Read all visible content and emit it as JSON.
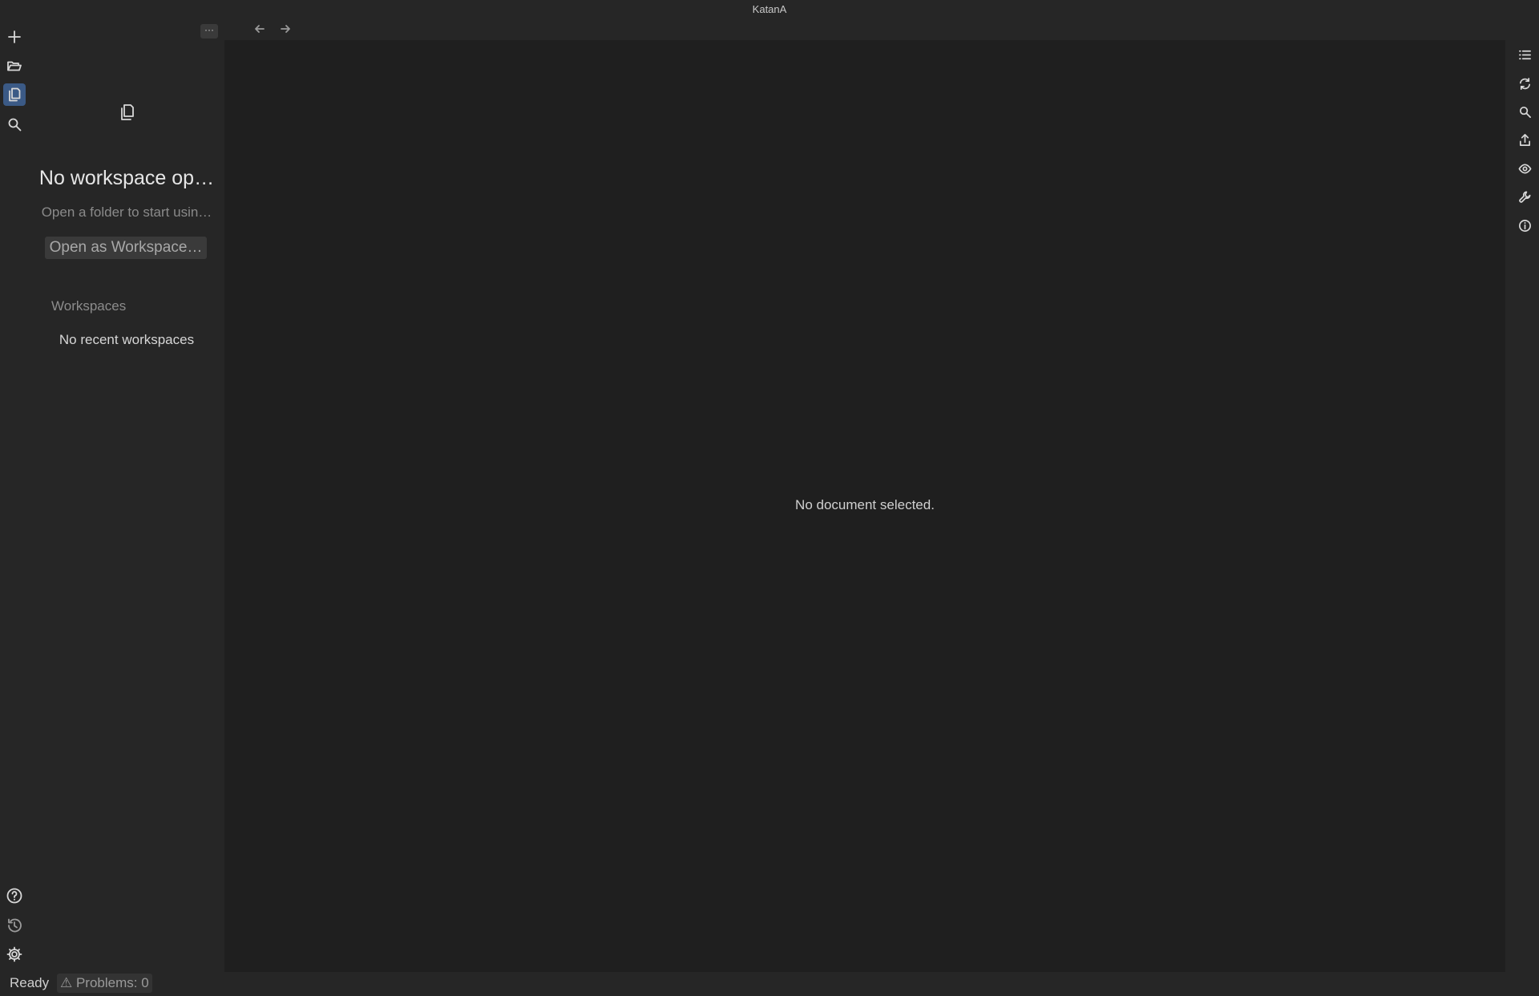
{
  "app": {
    "title": "KatanA"
  },
  "activity_bar": {
    "items": [
      {
        "icon": "plus-icon",
        "label": "New"
      },
      {
        "icon": "folder-open-icon",
        "label": "Open"
      },
      {
        "icon": "documents-icon",
        "label": "Explorer",
        "active": true
      },
      {
        "icon": "search-icon",
        "label": "Search"
      }
    ],
    "bottom": [
      {
        "icon": "help-icon"
      },
      {
        "icon": "history-icon"
      },
      {
        "icon": "gear-icon"
      }
    ]
  },
  "sidebar": {
    "more_label": "···",
    "title": "No workspace op…",
    "subtitle": "Open a folder to start usin…",
    "open_button": "Open as Workspace…",
    "workspaces_heading": "Workspaces",
    "workspaces_empty": "No recent workspaces"
  },
  "editor": {
    "empty_message": "No document selected."
  },
  "right_toolbar": {
    "items": [
      {
        "icon": "outline-list-icon"
      },
      {
        "icon": "refresh-icon"
      },
      {
        "icon": "search-icon"
      },
      {
        "icon": "export-icon"
      },
      {
        "icon": "eye-icon"
      },
      {
        "icon": "wrench-icon"
      },
      {
        "icon": "info-icon"
      }
    ]
  },
  "statusbar": {
    "ready": "Ready",
    "problems": "⚠ Problems: 0"
  },
  "colors": {
    "background": "#262626",
    "editor_background": "#1f1f1f",
    "active_accent": "#3b5a86"
  }
}
